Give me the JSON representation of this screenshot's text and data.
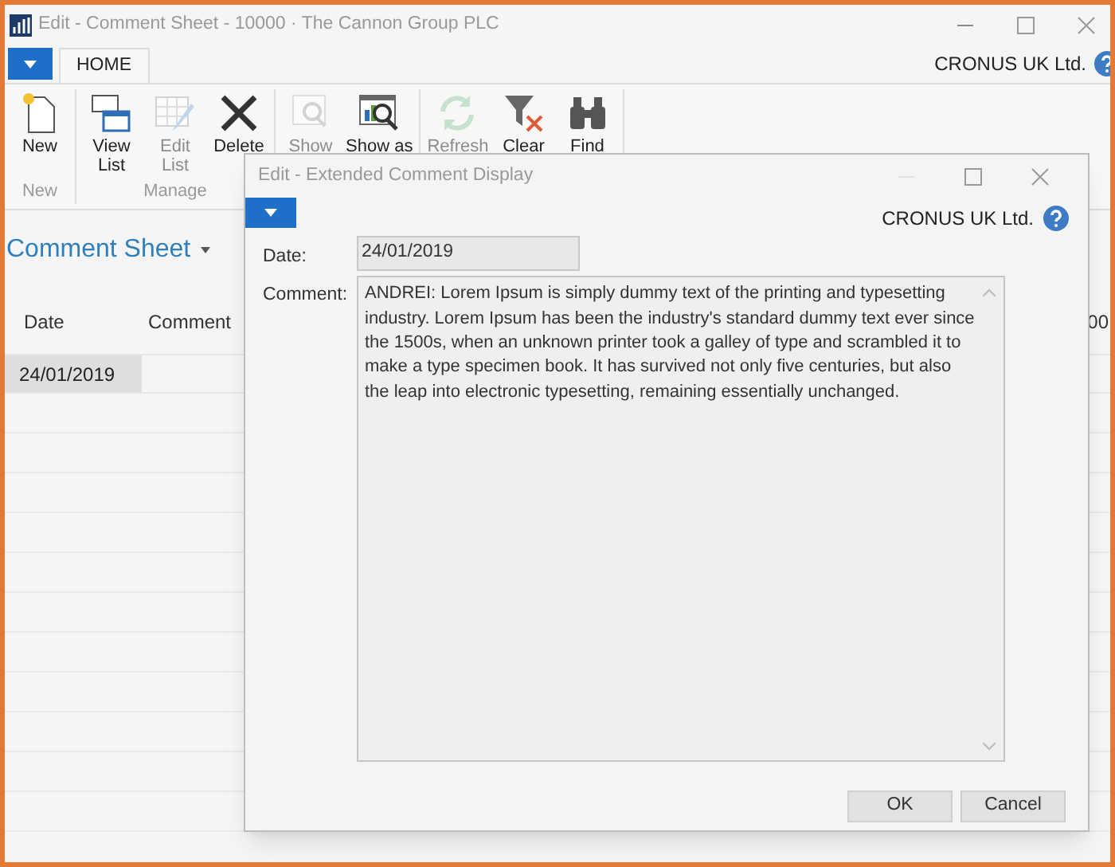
{
  "window": {
    "title": "Edit - Comment Sheet - 10000 · The Cannon Group PLC",
    "company": "CRONUS UK Ltd."
  },
  "tabs": [
    {
      "label": "HOME",
      "selected": true
    }
  ],
  "ribbon_groups": [
    {
      "label": "New",
      "buttons": [
        {
          "label": "New",
          "kind": "new",
          "disabled": false
        }
      ]
    },
    {
      "label": "Manage",
      "buttons": [
        {
          "label": "View\nList",
          "kind": "view-list",
          "disabled": false
        },
        {
          "label": "Edit\nList",
          "kind": "edit-list",
          "disabled": true
        },
        {
          "label": "Delete",
          "kind": "delete",
          "disabled": false
        }
      ]
    },
    {
      "buttons": [
        {
          "label": "Show",
          "kind": "show",
          "disabled": true
        },
        {
          "label": "Show as",
          "kind": "show-as",
          "disabled": false
        }
      ]
    },
    {
      "buttons": [
        {
          "label": "Refresh",
          "kind": "refresh",
          "disabled": true
        },
        {
          "label": "Clear",
          "kind": "clear",
          "disabled": false
        },
        {
          "label": "Find",
          "kind": "find",
          "disabled": false
        }
      ]
    }
  ],
  "page_title": "Comment Sheet",
  "list": {
    "columns": [
      "Date",
      "Comment"
    ],
    "rows": [
      {
        "date": "24/01/2019",
        "selected": true
      }
    ],
    "column_3_fragment": "00"
  },
  "dialog": {
    "title": "Edit - Extended Comment Display",
    "company": "CRONUS UK Ltd.",
    "fields": [
      {
        "label": "Date:",
        "value": "24/01/2019"
      },
      {
        "label": "Comment:",
        "value": "ANDREI: Lorem Ipsum is simply dummy text of the printing and typesetting industry. Lorem Ipsum has been the industry's standard dummy text ever since the 1500s, when an unknown printer took a galley of type and scrambled it to make a type specimen book. It has survived not only five centuries, but also the leap into electronic typesetting, remaining essentially unchanged."
      }
    ],
    "buttons": [
      "OK",
      "Cancel"
    ]
  }
}
